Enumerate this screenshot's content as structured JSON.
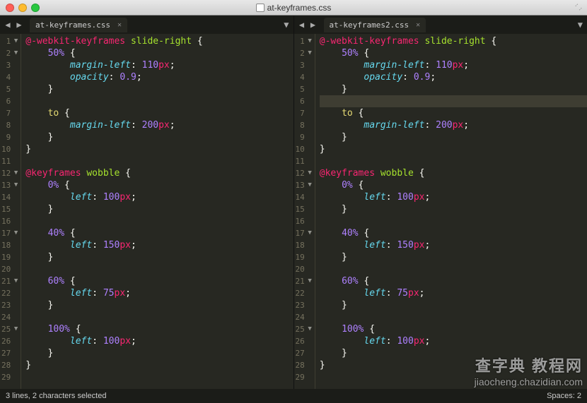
{
  "window": {
    "title": "at-keyframes.css"
  },
  "panes": [
    {
      "tab": "at-keyframes.css",
      "highlighted_line": null,
      "fold_lines": [
        1,
        2,
        12,
        13,
        17,
        21,
        25
      ],
      "lines": [
        [
          [
            "kw",
            "@-webkit-keyframes"
          ],
          [
            "punc",
            " "
          ],
          [
            "name",
            "slide-right"
          ],
          [
            "punc",
            " {"
          ]
        ],
        [
          [
            "punc",
            "    "
          ],
          [
            "const",
            "50%"
          ],
          [
            "punc",
            " {"
          ]
        ],
        [
          [
            "punc",
            "        "
          ],
          [
            "prop",
            "margin-left"
          ],
          [
            "punc",
            ": "
          ],
          [
            "num",
            "110"
          ],
          [
            "unit",
            "px"
          ],
          [
            "punc",
            ";"
          ]
        ],
        [
          [
            "punc",
            "        "
          ],
          [
            "prop",
            "opacity"
          ],
          [
            "punc",
            ": "
          ],
          [
            "num",
            "0.9"
          ],
          [
            "punc",
            ";"
          ]
        ],
        [
          [
            "punc",
            "    }"
          ]
        ],
        [
          [
            "punc",
            ""
          ]
        ],
        [
          [
            "punc",
            "    "
          ],
          [
            "sel",
            "to"
          ],
          [
            "punc",
            " {"
          ]
        ],
        [
          [
            "punc",
            "        "
          ],
          [
            "prop",
            "margin-left"
          ],
          [
            "punc",
            ": "
          ],
          [
            "num",
            "200"
          ],
          [
            "unit",
            "px"
          ],
          [
            "punc",
            ";"
          ]
        ],
        [
          [
            "punc",
            "    }"
          ]
        ],
        [
          [
            "punc",
            "}"
          ]
        ],
        [
          [
            "punc",
            ""
          ]
        ],
        [
          [
            "kw",
            "@keyframes"
          ],
          [
            "punc",
            " "
          ],
          [
            "name",
            "wobble"
          ],
          [
            "punc",
            " {"
          ]
        ],
        [
          [
            "punc",
            "    "
          ],
          [
            "const",
            "0%"
          ],
          [
            "punc",
            " {"
          ]
        ],
        [
          [
            "punc",
            "        "
          ],
          [
            "prop",
            "left"
          ],
          [
            "punc",
            ": "
          ],
          [
            "num",
            "100"
          ],
          [
            "unit",
            "px"
          ],
          [
            "punc",
            ";"
          ]
        ],
        [
          [
            "punc",
            "    }"
          ]
        ],
        [
          [
            "punc",
            ""
          ]
        ],
        [
          [
            "punc",
            "    "
          ],
          [
            "const",
            "40%"
          ],
          [
            "punc",
            " {"
          ]
        ],
        [
          [
            "punc",
            "        "
          ],
          [
            "prop",
            "left"
          ],
          [
            "punc",
            ": "
          ],
          [
            "num",
            "150"
          ],
          [
            "unit",
            "px"
          ],
          [
            "punc",
            ";"
          ]
        ],
        [
          [
            "punc",
            "    }"
          ]
        ],
        [
          [
            "punc",
            ""
          ]
        ],
        [
          [
            "punc",
            "    "
          ],
          [
            "const",
            "60%"
          ],
          [
            "punc",
            " {"
          ]
        ],
        [
          [
            "punc",
            "        "
          ],
          [
            "prop",
            "left"
          ],
          [
            "punc",
            ": "
          ],
          [
            "num",
            "75"
          ],
          [
            "unit",
            "px"
          ],
          [
            "punc",
            ";"
          ]
        ],
        [
          [
            "punc",
            "    }"
          ]
        ],
        [
          [
            "punc",
            ""
          ]
        ],
        [
          [
            "punc",
            "    "
          ],
          [
            "const",
            "100%"
          ],
          [
            "punc",
            " {"
          ]
        ],
        [
          [
            "punc",
            "        "
          ],
          [
            "prop",
            "left"
          ],
          [
            "punc",
            ": "
          ],
          [
            "num",
            "100"
          ],
          [
            "unit",
            "px"
          ],
          [
            "punc",
            ";"
          ]
        ],
        [
          [
            "punc",
            "    }"
          ]
        ],
        [
          [
            "punc",
            "}"
          ]
        ],
        [
          [
            "punc",
            ""
          ]
        ]
      ]
    },
    {
      "tab": "at-keyframes2.css",
      "highlighted_line": 6,
      "fold_lines": [
        1,
        2,
        12,
        13,
        17,
        21,
        25
      ],
      "lines": [
        [
          [
            "kw",
            "@-webkit-keyframes"
          ],
          [
            "punc",
            " "
          ],
          [
            "name",
            "slide-right"
          ],
          [
            "punc",
            " {"
          ]
        ],
        [
          [
            "punc",
            "    "
          ],
          [
            "const",
            "50%"
          ],
          [
            "punc",
            " {"
          ]
        ],
        [
          [
            "punc",
            "        "
          ],
          [
            "prop",
            "margin-left"
          ],
          [
            "punc",
            ": "
          ],
          [
            "num",
            "110"
          ],
          [
            "unit",
            "px"
          ],
          [
            "punc",
            ";"
          ]
        ],
        [
          [
            "punc",
            "        "
          ],
          [
            "prop",
            "opacity"
          ],
          [
            "punc",
            ": "
          ],
          [
            "num",
            "0.9"
          ],
          [
            "punc",
            ";"
          ]
        ],
        [
          [
            "punc",
            "    }"
          ]
        ],
        [
          [
            "punc",
            ""
          ]
        ],
        [
          [
            "punc",
            "    "
          ],
          [
            "sel",
            "to"
          ],
          [
            "punc",
            " {"
          ]
        ],
        [
          [
            "punc",
            "        "
          ],
          [
            "prop",
            "margin-left"
          ],
          [
            "punc",
            ": "
          ],
          [
            "num",
            "200"
          ],
          [
            "unit",
            "px"
          ],
          [
            "punc",
            ";"
          ]
        ],
        [
          [
            "punc",
            "    }"
          ]
        ],
        [
          [
            "punc",
            "}"
          ]
        ],
        [
          [
            "punc",
            ""
          ]
        ],
        [
          [
            "kw",
            "@keyframes"
          ],
          [
            "punc",
            " "
          ],
          [
            "name",
            "wobble"
          ],
          [
            "punc",
            " {"
          ]
        ],
        [
          [
            "punc",
            "    "
          ],
          [
            "const",
            "0%"
          ],
          [
            "punc",
            " {"
          ]
        ],
        [
          [
            "punc",
            "        "
          ],
          [
            "prop",
            "left"
          ],
          [
            "punc",
            ": "
          ],
          [
            "num",
            "100"
          ],
          [
            "unit",
            "px"
          ],
          [
            "punc",
            ";"
          ]
        ],
        [
          [
            "punc",
            "    }"
          ]
        ],
        [
          [
            "punc",
            ""
          ]
        ],
        [
          [
            "punc",
            "    "
          ],
          [
            "const",
            "40%"
          ],
          [
            "punc",
            " {"
          ]
        ],
        [
          [
            "punc",
            "        "
          ],
          [
            "prop",
            "left"
          ],
          [
            "punc",
            ": "
          ],
          [
            "num",
            "150"
          ],
          [
            "unit",
            "px"
          ],
          [
            "punc",
            ";"
          ]
        ],
        [
          [
            "punc",
            "    }"
          ]
        ],
        [
          [
            "punc",
            ""
          ]
        ],
        [
          [
            "punc",
            "    "
          ],
          [
            "const",
            "60%"
          ],
          [
            "punc",
            " {"
          ]
        ],
        [
          [
            "punc",
            "        "
          ],
          [
            "prop",
            "left"
          ],
          [
            "punc",
            ": "
          ],
          [
            "num",
            "75"
          ],
          [
            "unit",
            "px"
          ],
          [
            "punc",
            ";"
          ]
        ],
        [
          [
            "punc",
            "    }"
          ]
        ],
        [
          [
            "punc",
            ""
          ]
        ],
        [
          [
            "punc",
            "    "
          ],
          [
            "const",
            "100%"
          ],
          [
            "punc",
            " {"
          ]
        ],
        [
          [
            "punc",
            "        "
          ],
          [
            "prop",
            "left"
          ],
          [
            "punc",
            ": "
          ],
          [
            "num",
            "100"
          ],
          [
            "unit",
            "px"
          ],
          [
            "punc",
            ";"
          ]
        ],
        [
          [
            "punc",
            "    }"
          ]
        ],
        [
          [
            "punc",
            "}"
          ]
        ],
        [
          [
            "punc",
            ""
          ]
        ]
      ]
    }
  ],
  "statusbar": {
    "left": "3 lines, 2 characters selected",
    "spaces": "Spaces: 2"
  },
  "watermark": {
    "top": "查字典 教程网",
    "bottom": "jiaocheng.chazidian.com"
  }
}
